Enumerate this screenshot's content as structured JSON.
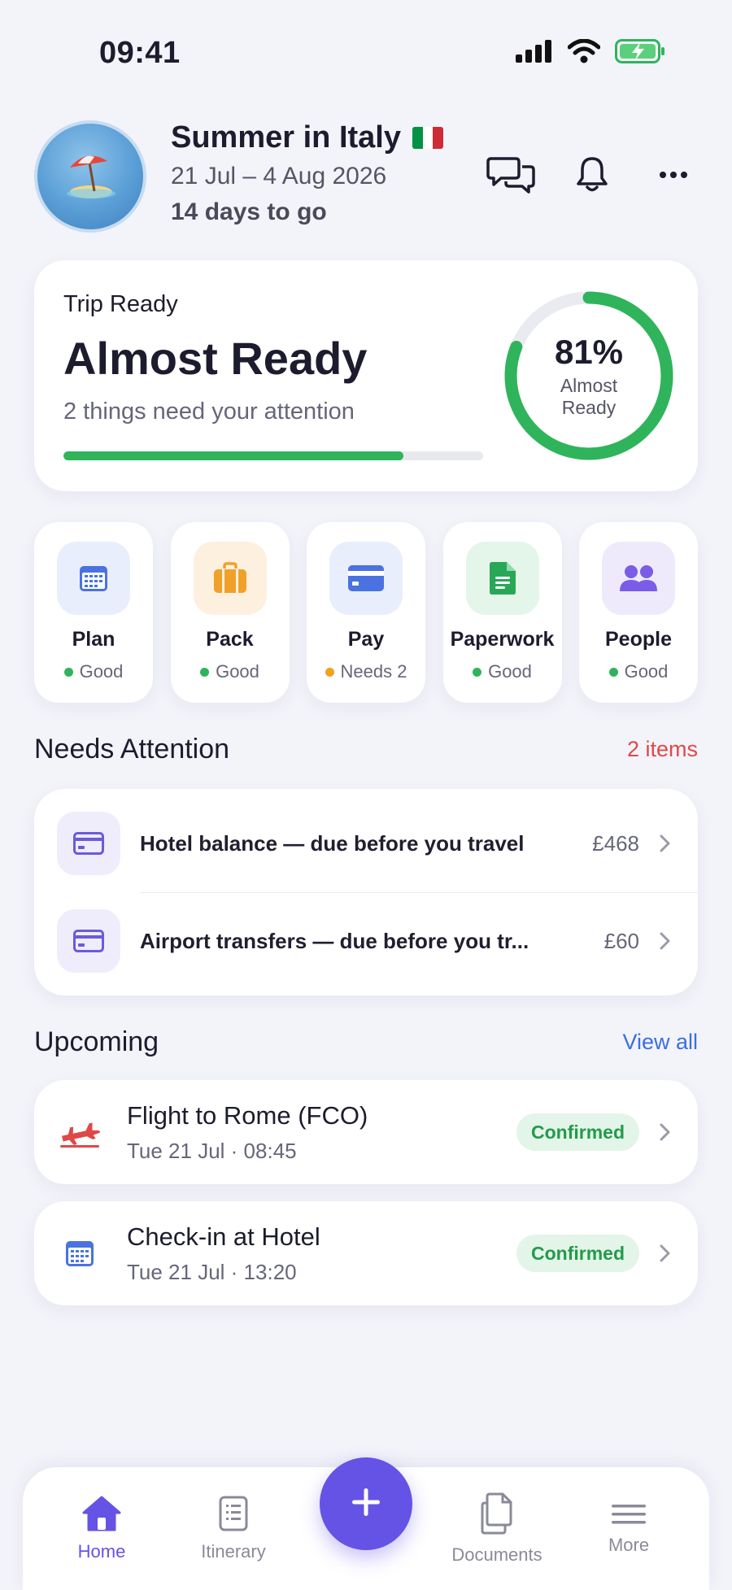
{
  "status_bar": {
    "time": "09:41"
  },
  "header": {
    "title": "Summer in Italy",
    "dates": "21 Jul – 4 Aug 2026",
    "countdown": "14 days to go",
    "avatar_icon": "beach-umbrella-icon",
    "flag_colors": [
      "#009246",
      "#ffffff",
      "#ce2b37"
    ]
  },
  "readiness": {
    "kicker": "Trip Ready",
    "title": "Almost Ready",
    "subtitle": "2 things need your attention",
    "percent": 81,
    "percent_label": "81%",
    "ring_label": "Almost Ready",
    "accent": "#2fb45c"
  },
  "categories": [
    {
      "name": "Plan",
      "status": "Good",
      "status_color": "#2fb45c",
      "icon": "calendar-icon",
      "tint": "#e8eefc",
      "icon_color": "#4a72e0"
    },
    {
      "name": "Pack",
      "status": "Good",
      "status_color": "#2fb45c",
      "icon": "suitcase-icon",
      "tint": "#fdf0df",
      "icon_color": "#f0a12a"
    },
    {
      "name": "Pay",
      "status": "Needs 2",
      "status_color": "#f2a11f",
      "icon": "credit-card-icon",
      "tint": "#e8eefc",
      "icon_color": "#4a72e0"
    },
    {
      "name": "Paperwork",
      "status": "Good",
      "status_color": "#2fb45c",
      "icon": "document-icon",
      "tint": "#e4f5ea",
      "icon_color": "#28a857"
    },
    {
      "name": "People",
      "status": "Good",
      "status_color": "#2fb45c",
      "icon": "people-icon",
      "tint": "#eeeafc",
      "icon_color": "#7a5ce6"
    }
  ],
  "attention": {
    "title": "Needs Attention",
    "count_label": "2 items",
    "count_color": "#e04848",
    "items": [
      {
        "text": "Hotel balance — due before you travel",
        "amount": "£468",
        "icon": "credit-card-icon"
      },
      {
        "text": "Airport transfers — due before you tr...",
        "amount": "£60",
        "icon": "credit-card-icon"
      }
    ]
  },
  "upcoming": {
    "title": "Upcoming",
    "view_all": "View all",
    "link_color": "#3b6fe0",
    "items": [
      {
        "title": "Flight to Rome (FCO)",
        "time": "Tue 21 Jul · 08:45",
        "status": "Confirmed",
        "icon": "airplane-icon"
      },
      {
        "title": "Check-in at Hotel",
        "time": "Tue 21 Jul · 13:20",
        "status": "Confirmed",
        "icon": "calendar-icon"
      }
    ]
  },
  "nav": {
    "items": [
      {
        "label": "Home",
        "icon": "home-icon",
        "active": true
      },
      {
        "label": "Itinerary",
        "icon": "itinerary-icon",
        "active": false
      },
      {
        "label": "Documents",
        "icon": "documents-icon",
        "active": false
      },
      {
        "label": "More",
        "icon": "menu-icon",
        "active": false
      }
    ],
    "fab_icon": "plus-icon",
    "accent": "#6553e6"
  }
}
